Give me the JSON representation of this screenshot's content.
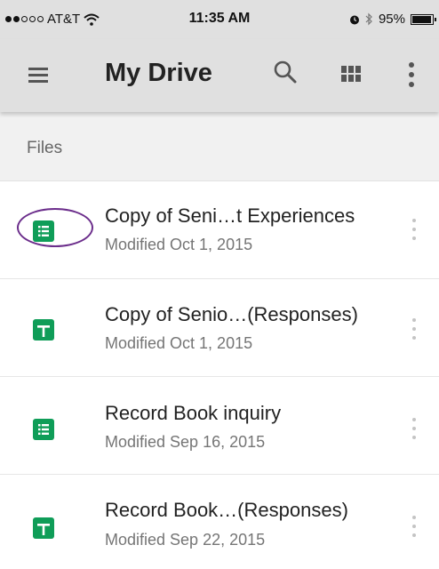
{
  "status_bar": {
    "signal_dots": [
      true,
      true,
      false,
      false,
      false
    ],
    "carrier": "AT&T",
    "time": "11:35 AM",
    "battery": "95%",
    "battery_level": 0.95
  },
  "app_bar": {
    "title": "My Drive",
    "menu_icon": "hamburger-menu-icon",
    "search_icon": "search-icon",
    "grid_icon": "grid-view-icon",
    "more_icon": "more-vert-icon"
  },
  "section": {
    "label": "Files"
  },
  "files": [
    {
      "name": "Copy of Seni…t Experiences",
      "modified": "Modified Oct 1, 2015",
      "icon": "form-icon",
      "highlighted": true
    },
    {
      "name": "Copy of Senio…(Responses)",
      "modified": "Modified Oct 1, 2015",
      "icon": "sheets-icon",
      "highlighted": false
    },
    {
      "name": "Record Book inquiry",
      "modified": "Modified Sep 16, 2015",
      "icon": "form-icon",
      "highlighted": false
    },
    {
      "name": "Record Book…(Responses)",
      "modified": "Modified Sep 22, 2015",
      "icon": "sheets-icon",
      "highlighted": false
    }
  ],
  "colors": {
    "app_bar": "#e0e0e0",
    "file_icon": "#0f9d58",
    "highlight_ring": "#6b2d8b"
  }
}
